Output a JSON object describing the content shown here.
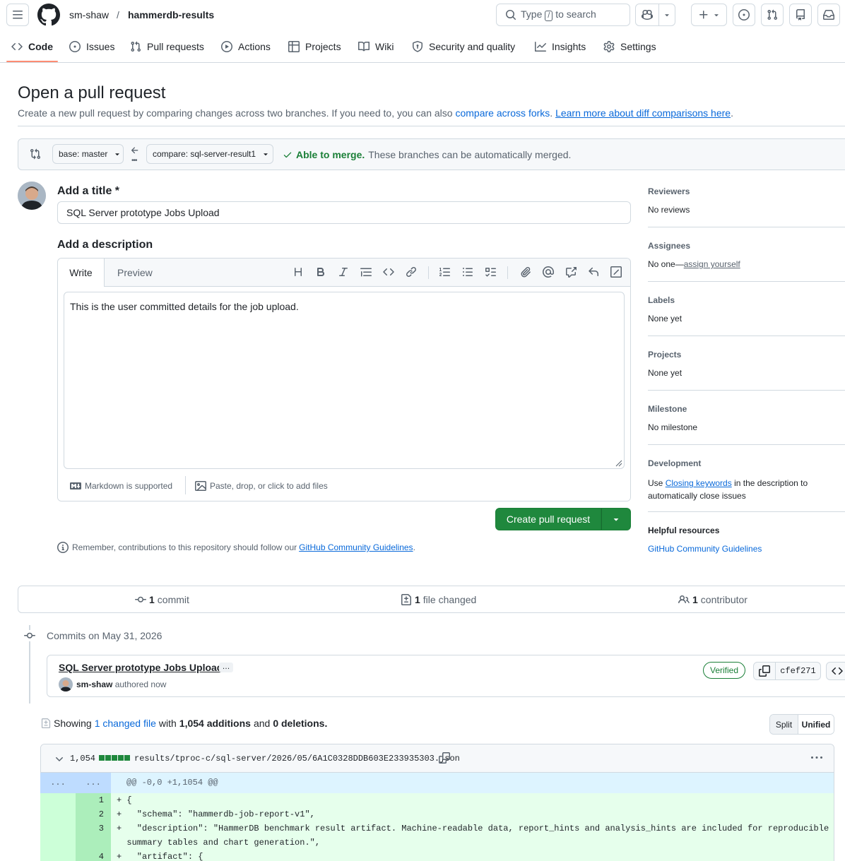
{
  "header": {
    "owner": "sm-shaw",
    "separator": "/",
    "repo": "hammerdb-results",
    "search_prefix": "Type",
    "search_key": "/",
    "search_suffix": "to search"
  },
  "nav": {
    "tabs": [
      {
        "label": "Code",
        "icon": "code-icon"
      },
      {
        "label": "Issues",
        "icon": "issue-icon"
      },
      {
        "label": "Pull requests",
        "icon": "pull-request-icon"
      },
      {
        "label": "Actions",
        "icon": "play-icon"
      },
      {
        "label": "Projects",
        "icon": "table-icon"
      },
      {
        "label": "Wiki",
        "icon": "book-icon"
      },
      {
        "label": "Security and quality",
        "icon": "shield-icon"
      },
      {
        "label": "Insights",
        "icon": "graph-icon"
      },
      {
        "label": "Settings",
        "icon": "gear-icon"
      }
    ]
  },
  "page": {
    "title": "Open a pull request",
    "subtitle_prefix": "Create a new pull request by comparing changes across two branches. If you need to, you can also",
    "compare_forks_link": "compare across forks",
    "subtitle_mid": ".",
    "learn_more_link": "Learn more about diff comparisons here",
    "subtitle_end": "."
  },
  "compare": {
    "base_label": "base: master",
    "compare_label": "compare: sql-server-result1",
    "merge_status": "Able to merge.",
    "merge_detail": "These branches can be automatically merged."
  },
  "form": {
    "title_label": "Add a title",
    "required_mark": "*",
    "title_value": "SQL Server prototype Jobs Upload",
    "description_label": "Add a description",
    "tab_write": "Write",
    "tab_preview": "Preview",
    "description_value": "This is the user committed details for the job upload.",
    "markdown_note": "Markdown is supported",
    "attach_note": "Paste, drop, or click to add files",
    "submit_label": "Create pull request",
    "guidelines_prefix": "Remember, contributions to this repository should follow our",
    "guidelines_link": "GitHub Community Guidelines",
    "guidelines_end": "."
  },
  "sidebar": {
    "reviewers_label": "Reviewers",
    "reviewers_value": "No reviews",
    "assignees_label": "Assignees",
    "assignees_value": "No one—",
    "assignees_link": "assign yourself",
    "labels_label": "Labels",
    "labels_value": "None yet",
    "projects_label": "Projects",
    "projects_value": "None yet",
    "milestone_label": "Milestone",
    "milestone_value": "No milestone",
    "development_label": "Development",
    "development_prefix": "Use",
    "development_link": "Closing keywords",
    "development_mid": "in the description to",
    "development_end": "automatically close issues",
    "helpful_label": "Helpful resources",
    "helpful_link": "GitHub Community Guidelines"
  },
  "summary": {
    "commits_count": "1",
    "commits_label": "commit",
    "files_count": "1",
    "files_label": "file changed",
    "contrib_count": "1",
    "contrib_label": "contributor"
  },
  "commits": {
    "date_heading": "Commits on May 31, 2026",
    "message": "SQL Server prototype Jobs Upload",
    "ellipsis": "…",
    "author": "sm-shaw",
    "authored": "authored now",
    "verified": "Verified",
    "sha": "cfef271"
  },
  "diffstat": {
    "showing": "Showing",
    "changed_link": "1 changed file",
    "with": "with",
    "additions": "1,054 additions",
    "and": "and",
    "deletions": "0 deletions.",
    "split_label": "Split",
    "unified_label": "Unified"
  },
  "file": {
    "count": "1,054",
    "path": "results/tproc-c/sql-server/2026/05/6A1C0328DDB603E233935303.json",
    "hunk_left": "...",
    "hunk_right": "...",
    "hunk": "@@ -0,0 +1,1054 @@",
    "lines": [
      {
        "num": "1",
        "text": "+ {"
      },
      {
        "num": "2",
        "text": "+   \"schema\": \"hammerdb-job-report-v1\","
      },
      {
        "num": "3",
        "text": "+   \"description\": \"HammerDB benchmark result artifact. Machine-readable data, report_hints and analysis_hints are included for reproducible reporting,"
      },
      {
        "num": "",
        "text": "  summary tables and chart generation.\","
      },
      {
        "num": "4",
        "text": "+   \"artifact\": {"
      }
    ]
  },
  "colors": {
    "accent": "#0969da",
    "success": "#1a7f37",
    "underline_active": "#fd8c73"
  }
}
